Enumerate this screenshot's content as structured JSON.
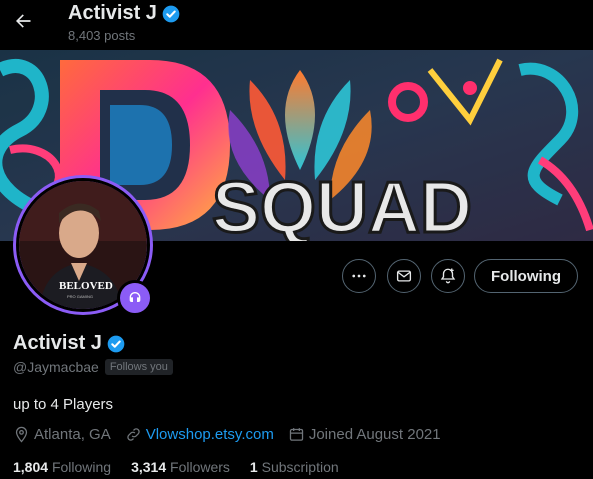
{
  "header": {
    "name": "Activist J",
    "posts": "8,403 posts"
  },
  "banner": {
    "text_left": "D",
    "text_main": "SQUAD"
  },
  "avatar": {
    "text": "BELOVED",
    "subtext": "PRO GAMING"
  },
  "actions": {
    "following_label": "Following"
  },
  "profile": {
    "name": "Activist J",
    "handle": "@Jaymacbae",
    "follows_you": "Follows you",
    "bio": "up to 4 Players",
    "location": "Atlanta, GA",
    "website": "Vlowshop.etsy.com",
    "joined": "Joined August 2021"
  },
  "stats": {
    "following_count": "1,804",
    "following_label": "Following",
    "followers_count": "3,314",
    "followers_label": "Followers",
    "subscription_count": "1",
    "subscription_label": "Subscription"
  },
  "colors": {
    "accent": "#1d9bf0",
    "badge": "#8b5cf6",
    "muted": "#71767b"
  }
}
